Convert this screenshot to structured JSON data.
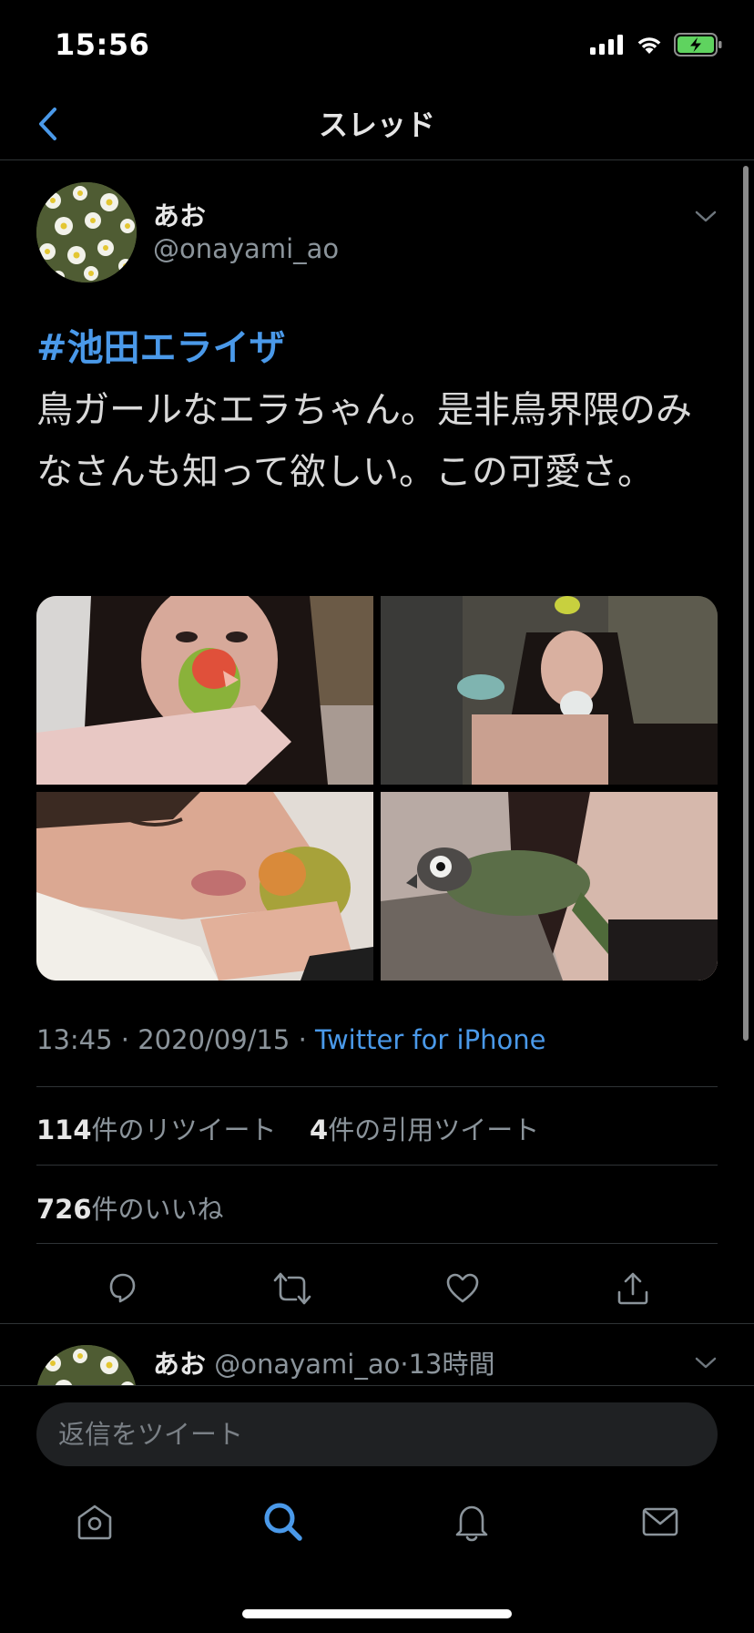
{
  "status": {
    "time": "15:56"
  },
  "nav": {
    "title": "スレッド"
  },
  "tweet": {
    "author_name": "あお",
    "author_handle": "@onayami_ao",
    "hashtag": "#池田エライザ",
    "text": "鳥ガールなエラちゃん。是非鳥界隈のみなさんも知って欲しい。この可愛さ。",
    "time": "13:45",
    "date": "2020/09/15",
    "separator": " · ",
    "source": "Twitter for iPhone",
    "retweet_count": "114",
    "retweet_label": "件のリツイート",
    "quote_count": "4",
    "quote_label": "件の引用ツイート",
    "like_count": "726",
    "like_label": "件のいいね"
  },
  "reply": {
    "author_name": "あお",
    "author_handle": "@onayami_ao",
    "dot": "·",
    "time_ago": "13時間"
  },
  "compose": {
    "placeholder": "返信をツイート"
  },
  "colors": {
    "accent": "#4a99e9",
    "background": "#000000",
    "muted": "#8b949b",
    "divider": "#2f3336"
  },
  "icons": [
    "back-icon",
    "signal-icon",
    "wifi-icon",
    "battery-icon",
    "chevron-down-icon",
    "reply-icon",
    "retweet-icon",
    "like-icon",
    "share-icon",
    "home-icon",
    "search-icon",
    "notifications-icon",
    "messages-icon"
  ]
}
